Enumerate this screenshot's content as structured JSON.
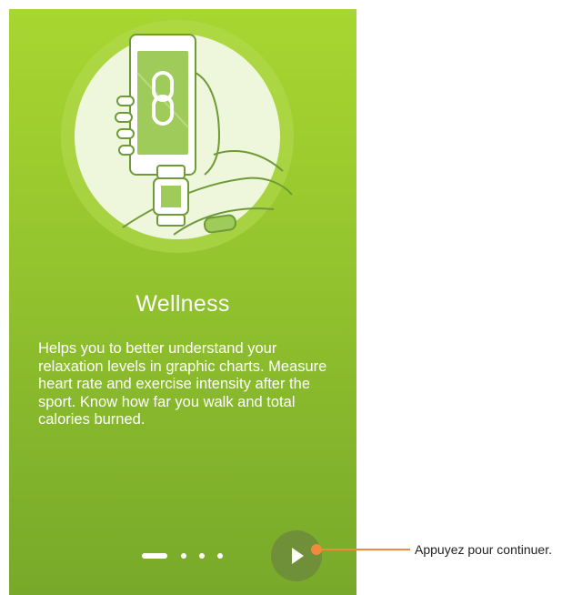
{
  "onboarding": {
    "title": "Wellness",
    "description": "Helps you to better understand your relaxation levels in graphic charts. Measure heart rate and exercise intensity after the sport. Know how far you walk and total calories burned.",
    "page_indicator": {
      "current": 1,
      "total": 4
    },
    "next_button_icon": "play-icon",
    "illustration_icon": "phone-watch-link-icon"
  },
  "callout": {
    "text": "Appuyez pour continuer."
  },
  "colors": {
    "background_top": "#a8d630",
    "background_bottom": "#78a92a",
    "next_button": "#6f8f38",
    "callout": "#f08a3c"
  }
}
